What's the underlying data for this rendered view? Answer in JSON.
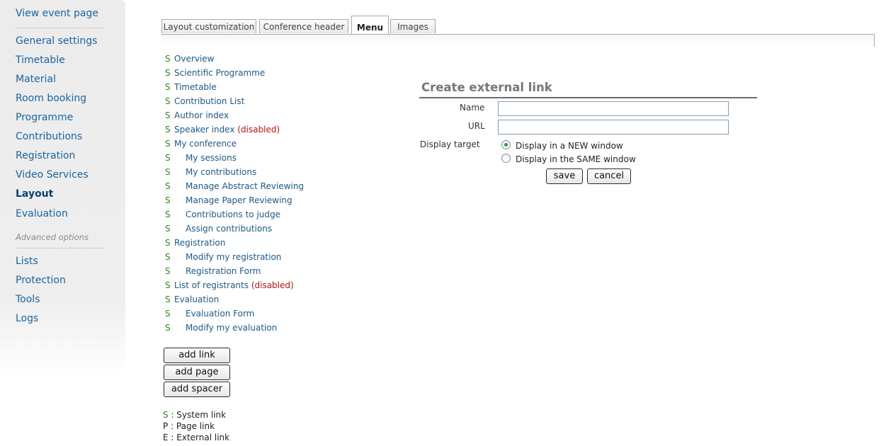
{
  "sidebar": {
    "view_event": "View event page",
    "items": [
      {
        "label": "General settings"
      },
      {
        "label": "Timetable"
      },
      {
        "label": "Material"
      },
      {
        "label": "Room booking"
      },
      {
        "label": "Programme"
      },
      {
        "label": "Contributions"
      },
      {
        "label": "Registration"
      },
      {
        "label": "Video Services"
      },
      {
        "label": "Layout"
      },
      {
        "label": "Evaluation"
      }
    ],
    "advanced_title": "Advanced options",
    "advanced_items": [
      {
        "label": "Lists"
      },
      {
        "label": "Protection"
      },
      {
        "label": "Tools"
      },
      {
        "label": "Logs"
      }
    ]
  },
  "tabs": [
    {
      "label": "Layout customization"
    },
    {
      "label": "Conference header"
    },
    {
      "label": "Menu"
    },
    {
      "label": "Images"
    }
  ],
  "menu": [
    {
      "type": "S",
      "label": "Overview",
      "note": ""
    },
    {
      "type": "S",
      "label": "Scientific Programme",
      "note": ""
    },
    {
      "type": "S",
      "label": "Timetable",
      "note": ""
    },
    {
      "type": "S",
      "label": "Contribution List",
      "note": ""
    },
    {
      "type": "S",
      "label": "Author index",
      "note": ""
    },
    {
      "type": "S",
      "label": "Speaker index",
      "note": "(disabled)"
    },
    {
      "type": "S",
      "label": "My conference",
      "note": ""
    },
    {
      "type": "S",
      "label": "My sessions",
      "note": ""
    },
    {
      "type": "S",
      "label": "My contributions",
      "note": ""
    },
    {
      "type": "S",
      "label": "Manage Abstract Reviewing",
      "note": ""
    },
    {
      "type": "S",
      "label": "Manage Paper Reviewing",
      "note": ""
    },
    {
      "type": "S",
      "label": "Contributions to judge",
      "note": ""
    },
    {
      "type": "S",
      "label": "Assign contributions",
      "note": ""
    },
    {
      "type": "S",
      "label": "Registration",
      "note": ""
    },
    {
      "type": "S",
      "label": "Modify my registration",
      "note": ""
    },
    {
      "type": "S",
      "label": "Registration Form",
      "note": ""
    },
    {
      "type": "S",
      "label": "List of registrants",
      "note": "(disabled)"
    },
    {
      "type": "S",
      "label": "Evaluation",
      "note": ""
    },
    {
      "type": "S",
      "label": "Evaluation Form",
      "note": ""
    },
    {
      "type": "S",
      "label": "Modify my evaluation",
      "note": ""
    }
  ],
  "buttons": {
    "add_link": "add link",
    "add_page": "add page",
    "add_spacer": "add spacer"
  },
  "legend": [
    {
      "key": "S",
      "text": ": System link"
    },
    {
      "key": "P",
      "text": ": Page link"
    },
    {
      "key": "E",
      "text": ": External link"
    }
  ],
  "form": {
    "title": "Create external link",
    "name_label": "Name",
    "name_value": "",
    "url_label": "URL",
    "url_value": "",
    "target_label": "Display target",
    "option_new": "Display in a NEW window",
    "option_same": "Display in the SAME window",
    "selected_option": "new",
    "save": "save",
    "cancel": "cancel"
  },
  "colors": {
    "link": "#1a5a94",
    "system_marker": "#2a8a1a",
    "disabled": "#cc1111"
  }
}
